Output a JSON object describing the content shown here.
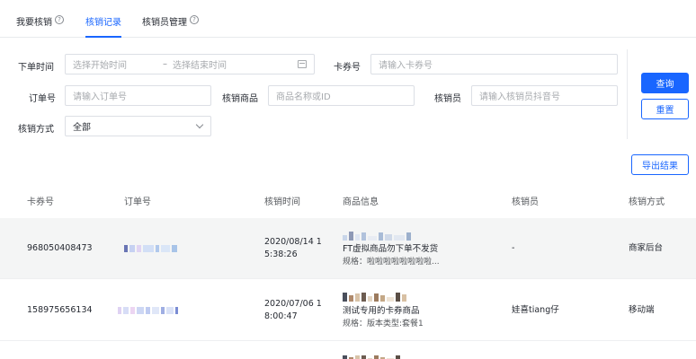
{
  "tabs": [
    {
      "label": "我要核销",
      "help": "?"
    },
    {
      "label": "核销记录"
    },
    {
      "label": "核销员管理",
      "help": "?"
    }
  ],
  "filters": {
    "order_time_label": "下单时间",
    "start_placeholder": "选择开始时间",
    "range_separator": "–",
    "end_placeholder": "选择结束时间",
    "coupon_label": "卡券号",
    "coupon_placeholder": "请输入卡券号",
    "order_label": "订单号",
    "order_placeholder": "请输入订单号",
    "product_label": "核销商品",
    "product_placeholder": "商品名称或ID",
    "verifier_label": "核销员",
    "verifier_placeholder": "请输入核销员抖音号",
    "method_label": "核销方式",
    "method_value": "全部"
  },
  "buttons": {
    "query": "查询",
    "reset": "重置",
    "export": "导出结果"
  },
  "table": {
    "columns": [
      "卡券号",
      "订单号",
      "核销时间",
      "商品信息",
      "核销员",
      "核销方式"
    ],
    "rows": [
      {
        "coupon": "968050408473",
        "time_line1": "2020/08/14 1",
        "time_line2": "5:38:26",
        "product_name": "FT虚拟商品勿下单不发货",
        "product_spec": "规格：啦啦啦啦啦啦啦啦...",
        "verifier": "-",
        "method": "商家后台"
      },
      {
        "coupon": "158975656134",
        "time_line1": "2020/07/06 1",
        "time_line2": "8:00:47",
        "product_name": "测试专用的卡券商品",
        "product_spec": "规格：版本类型:套餐1",
        "verifier": "娃喜tiang仔",
        "method": "移动端"
      }
    ]
  },
  "colors": {
    "accent": "#1966ff",
    "row_highlight": "#f4f5f5",
    "border": "#dcdfe5"
  }
}
